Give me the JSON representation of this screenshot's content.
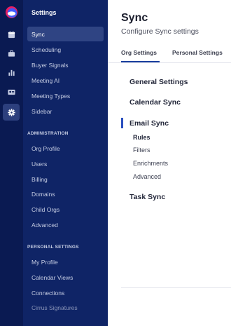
{
  "rail": {
    "items": [
      {
        "icon": "calendar-icon"
      },
      {
        "icon": "briefcase-icon"
      },
      {
        "icon": "bar-chart-icon"
      },
      {
        "icon": "id-card-icon"
      },
      {
        "icon": "gear-icon",
        "active": true
      }
    ]
  },
  "sidebar": {
    "title": "Settings",
    "items": [
      {
        "label": "Sync"
      },
      {
        "label": "Scheduling"
      },
      {
        "label": "Buyer Signals"
      },
      {
        "label": "Meeting AI"
      },
      {
        "label": "Meeting Types"
      },
      {
        "label": "Sidebar"
      }
    ],
    "administration": {
      "heading": "ADMINISTRATION",
      "items": [
        {
          "label": "Org Profile"
        },
        {
          "label": "Users"
        },
        {
          "label": "Billing"
        },
        {
          "label": "Domains"
        },
        {
          "label": "Child Orgs"
        },
        {
          "label": "Advanced"
        }
      ]
    },
    "personal": {
      "heading": "PERSONAL SETTINGS",
      "items": [
        {
          "label": "My Profile"
        },
        {
          "label": "Calendar Views"
        },
        {
          "label": "Connections"
        },
        {
          "label": "Cirrus Signatures"
        }
      ]
    }
  },
  "main": {
    "title": "Sync",
    "subtitle": "Configure Sync settings",
    "tabs": [
      {
        "label": "Org Settings",
        "active": true
      },
      {
        "label": "Personal Settings"
      }
    ],
    "nav": {
      "general": "General Settings",
      "calendar": "Calendar Sync",
      "email": "Email Sync",
      "email_items": [
        {
          "label": "Rules"
        },
        {
          "label": "Filters"
        },
        {
          "label": "Enrichments"
        },
        {
          "label": "Advanced"
        }
      ],
      "task": "Task Sync"
    }
  },
  "colors": {
    "rail_bg": "#0a1a52",
    "sidebar_bg": "#0f2466",
    "active_item_bg": "#2f4483",
    "accent": "#1a3f9e"
  }
}
